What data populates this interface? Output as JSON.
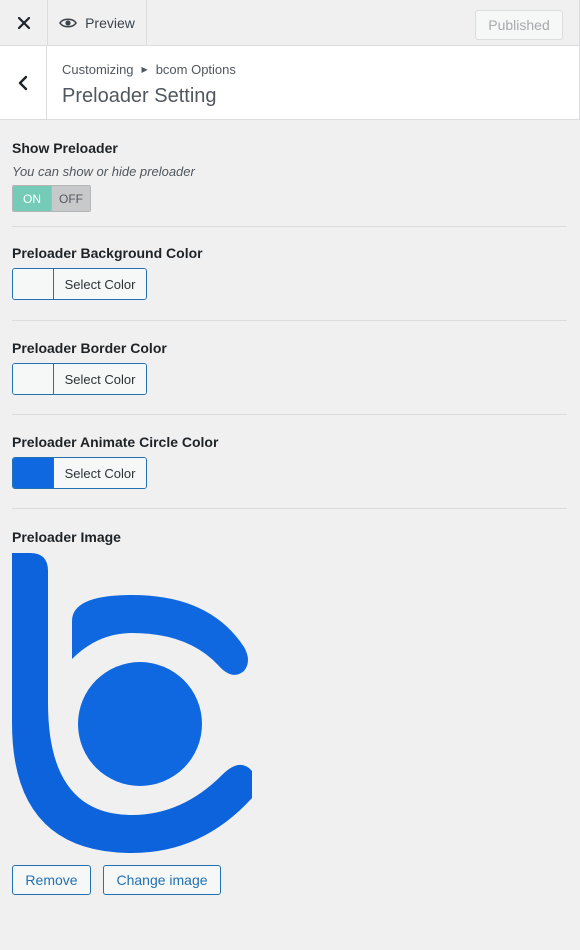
{
  "topbar": {
    "close_icon": "close-icon",
    "preview_label": "Preview",
    "preview_icon": "eye-icon",
    "published_label": "Published"
  },
  "header": {
    "back_icon": "chevron-left-icon",
    "breadcrumb_root": "Customizing",
    "breadcrumb_section": "bcom Options",
    "title": "Preloader Setting"
  },
  "controls": {
    "show_preloader": {
      "title": "Show Preloader",
      "description": "You can show or hide preloader",
      "on_label": "ON",
      "off_label": "OFF",
      "state": "on"
    },
    "bg_color": {
      "title": "Preloader Background Color",
      "button_label": "Select Color",
      "swatch": "#f6f7f7"
    },
    "border_color": {
      "title": "Preloader Border Color",
      "button_label": "Select Color",
      "swatch": "#f6f7f7"
    },
    "circle_color": {
      "title": "Preloader Animate Circle Color",
      "button_label": "Select Color",
      "swatch": "#1068e0"
    },
    "image": {
      "title": "Preloader Image",
      "remove_label": "Remove",
      "change_label": "Change image",
      "logo_color": "#0d63dc"
    }
  }
}
